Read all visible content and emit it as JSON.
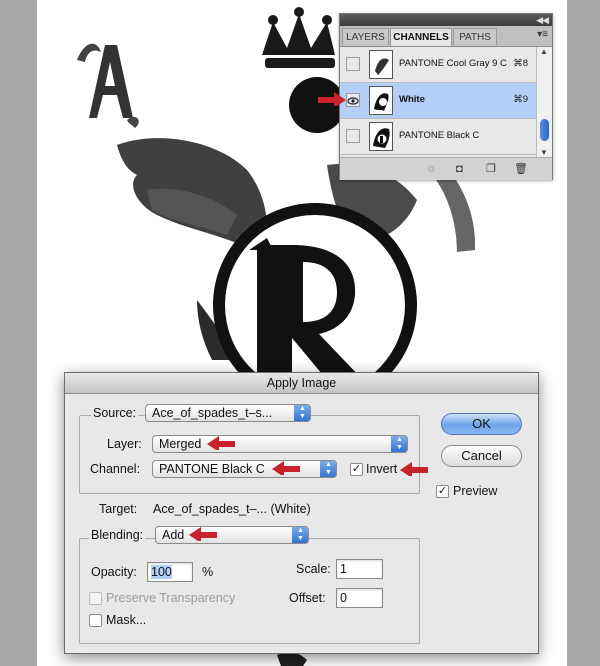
{
  "panel": {
    "tabs": [
      "LAYERS",
      "CHANNELS",
      "PATHS"
    ],
    "active_tab": "CHANNELS",
    "channels": [
      {
        "name": "PANTONE Cool Gray 9 C",
        "shortcut": "⌘8",
        "visible": false,
        "selected": false
      },
      {
        "name": "White",
        "shortcut": "⌘9",
        "visible": true,
        "selected": true
      },
      {
        "name": "PANTONE Black C",
        "shortcut": "",
        "visible": false,
        "selected": false
      }
    ]
  },
  "dialog": {
    "title": "Apply Image",
    "source_label": "Source:",
    "source_value": "Ace_of_spades_t–s...",
    "layer_label": "Layer:",
    "layer_value": "Merged",
    "channel_label": "Channel:",
    "channel_value": "PANTONE Black C",
    "invert_label": "Invert",
    "invert_checked": true,
    "target_label": "Target:",
    "target_value": "Ace_of_spades_t–... (White)",
    "blending_label": "Blending:",
    "blending_value": "Add",
    "opacity_label": "Opacity:",
    "opacity_value": "100",
    "opacity_unit": "%",
    "scale_label": "Scale:",
    "scale_value": "1",
    "offset_label": "Offset:",
    "offset_value": "0",
    "preserve_label": "Preserve Transparency",
    "mask_label": "Mask...",
    "ok_label": "OK",
    "cancel_label": "Cancel",
    "preview_label": "Preview",
    "preview_checked": true
  },
  "colors": {
    "annotation_arrow": "#c8232c",
    "selection": "#b4cff5",
    "accent": "#2f6fd0"
  }
}
